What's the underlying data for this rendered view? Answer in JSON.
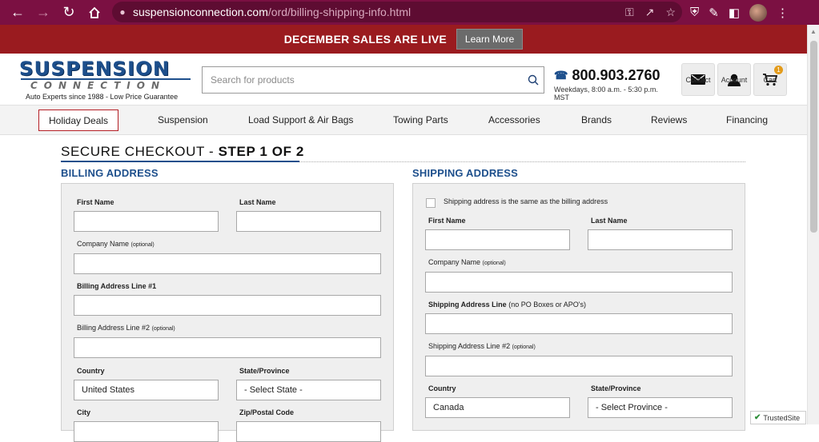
{
  "browser": {
    "url_domain": "suspensionconnection.com",
    "url_path": "/ord/billing-shipping-info.html"
  },
  "promo": {
    "text": "DECEMBER SALES ARE LIVE",
    "button": "Learn More"
  },
  "logo": {
    "line1": "SUSPENSION",
    "line2": "CONNECTION",
    "tagline": "Auto Experts since 1988 - Low Price Guarantee"
  },
  "search": {
    "placeholder": "Search for products"
  },
  "phone": {
    "number": "800.903.2760",
    "hours": "Weekdays, 8:00 a.m. - 5:30 p.m. MST"
  },
  "header_buttons": {
    "contact": "Contact",
    "account": "Account",
    "cart": "Cart",
    "cart_count": "1"
  },
  "nav": [
    "Holiday Deals",
    "Suspension",
    "Load Support & Air Bags",
    "Towing Parts",
    "Accessories",
    "Brands",
    "Reviews",
    "Financing"
  ],
  "checkout": {
    "title_prefix": "SECURE CHECKOUT - ",
    "title_step": "STEP 1 OF 2"
  },
  "billing": {
    "heading": "BILLING ADDRESS",
    "first_name": "First Name",
    "last_name": "Last Name",
    "company": "Company Name",
    "optional": "(optional)",
    "line1": "Billing Address Line #1",
    "line2": "Billing Address Line #2",
    "country": "Country",
    "country_value": "United States",
    "state": "State/Province",
    "state_value": "- Select State -",
    "city": "City",
    "zip": "Zip/Postal Code"
  },
  "shipping": {
    "heading": "SHIPPING ADDRESS",
    "same_as_billing": "Shipping address is the same as the billing address",
    "first_name": "First Name",
    "last_name": "Last Name",
    "company": "Company Name",
    "optional": "(optional)",
    "line1": "Shipping Address Line",
    "line1_note": "(no PO Boxes or APO's)",
    "line2": "Shipping Address Line #2",
    "country": "Country",
    "country_value": "Canada",
    "state": "State/Province",
    "state_value": "- Select Province -"
  },
  "trusted": "TrustedSite",
  "colors": {
    "chrome": "#7b1042",
    "promo": "#9a1b1f",
    "brand_blue": "#1d4f8c"
  }
}
